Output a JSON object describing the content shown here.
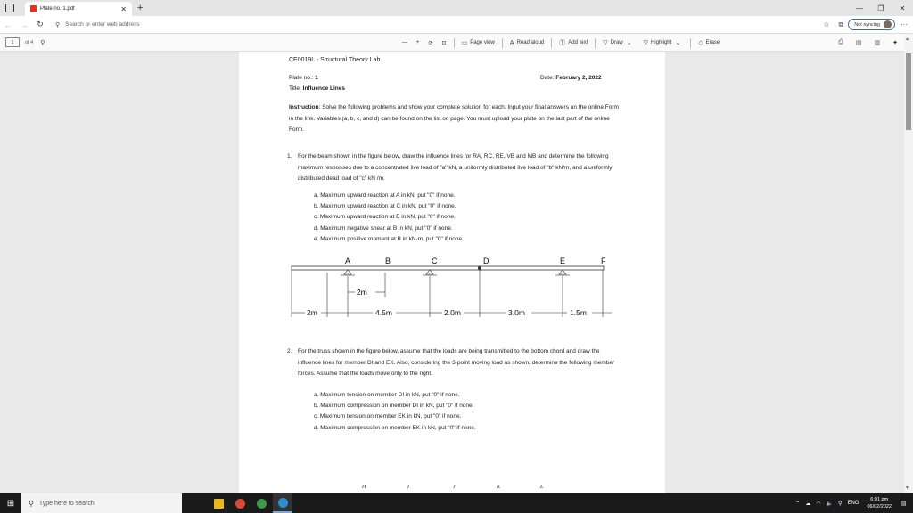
{
  "browser": {
    "tab_title": "Plate no. 1.pdf",
    "address_placeholder": "Search or enter web address",
    "sync_label": "Not syncing"
  },
  "pdf_toolbar": {
    "page_current": "1",
    "page_total": "of 4",
    "zoom_out": "—",
    "zoom_in": "+",
    "page_view": "Page view",
    "read_aloud": "Read aloud",
    "add_text": "Add text",
    "draw": "Draw",
    "highlight": "Highlight",
    "erase": "Erase"
  },
  "document": {
    "course": "CE0019L - Structural Theory Lab",
    "plate_label": "Plate no.: ",
    "plate_value": "1",
    "date_label": "Date: ",
    "date_value": "February 2, 2022",
    "title_label": "Title: ",
    "title_value": "Influence Lines",
    "instruction_label": "Instruction",
    "instruction_text": ": Solve the following problems and show your complete solution for each. Input your final answers on the online Form in the link. Variables (a, b, c, and d) can be found on the list on page. You must upload your plate on the last part of the online Form.",
    "q1_num": "1.",
    "q1_text": "For the beam shown in the figure below, draw the influence lines for RA, RC, RE, VB and MB and determine the following maximum responses due to a concentrated live load of \"a\" kN, a uniformly distributed live load of \"b\" kN/m, and a uniformly distributed dead load of \"c\" kN /m.",
    "q1_items": [
      "a. Maximum upward reaction at A in kN, put \"0\" if none.",
      "b. Maximum upward reaction at C in kN, put \"0\" if none.",
      "c. Maximum upward reaction at E in kN, put \"0\" if none.",
      "d. Maximum negative shear at B in kN, put \"0\" if none.",
      "e. Maximum positive moment at B in kN-m, put \"0\" if none."
    ],
    "beam": {
      "points": [
        "A",
        "B",
        "C",
        "D",
        "E",
        "F"
      ],
      "dims": [
        "2m",
        "4.5m",
        "2.0m",
        "3.0m",
        "1.5m"
      ],
      "dim_inner": "2m"
    },
    "q2_num": "2.",
    "q2_text": "For the truss shown in the figure below, assume that the loads are being transmitted to the bottom chord and draw the influence lines for member DI and EK. Also, considering the 3-point moving load as shown, determine the following member forces. Assume that the loads move only to the right.",
    "q2_items": [
      "a.   Maximum tension on member DI in kN, put \"0\" if none.",
      "b.   Maximum compression on member DI in kN, put \"0\" if none.",
      "c.   Maximum tension on member EK in kN, put \"0\" if none.",
      "d.   Maximum compression on member EK in kN, put \"0\" if none."
    ],
    "truss_labels": [
      "H",
      "I",
      "J",
      "K",
      "L"
    ]
  },
  "taskbar": {
    "search_placeholder": "Type here to search",
    "time": "6:01 pm",
    "date": "06/02/2022",
    "lang": "ENG"
  }
}
